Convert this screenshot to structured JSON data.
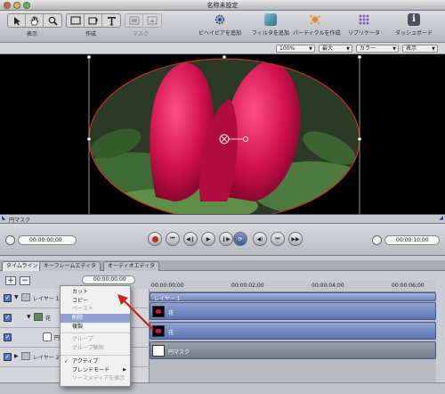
{
  "window": {
    "title": "名称未設定"
  },
  "toolbar": {
    "groups": [
      {
        "id": "view",
        "label": "表示"
      },
      {
        "id": "create",
        "label": "作成"
      },
      {
        "id": "mask",
        "label": "マスク"
      }
    ],
    "actions": [
      {
        "label": "ビヘイビアを追加",
        "icon": "gear-icon",
        "color": "#8ea3c9"
      },
      {
        "label": "フィルタを追加",
        "icon": "filter-icon",
        "color": "#5a9fb5"
      },
      {
        "label": "パーティクルを作成",
        "icon": "particles-icon",
        "color": "#d87a3a"
      },
      {
        "label": "リプリケータ",
        "icon": "replicator-icon",
        "color": "#7b5db8"
      },
      {
        "label": "ダッシュボード",
        "icon": "info-icon",
        "color": "#5a5d66"
      }
    ]
  },
  "viewbar": {
    "zoom": "100%",
    "quality": "最大",
    "channel": "カラー",
    "view": "表示"
  },
  "canvas": {
    "mask_name": "円マスク"
  },
  "transport": {
    "start_tc": "00:00:00;00",
    "end_tc": "00:00:10;00"
  },
  "tabs": [
    "タイムライン",
    "キーフレームエディタ",
    "オーディオエディタ"
  ],
  "timeline": {
    "current_tc": "00:00:00;00",
    "ruler": [
      "00:00:00;00",
      "00:00:02;00",
      "00:00:04;00",
      "00:00:06;00"
    ],
    "tracks": [
      {
        "label": "レイヤー 1",
        "indent": 0
      },
      {
        "label": "花",
        "indent": 1
      },
      {
        "label": "円マスク",
        "indent": 2
      },
      {
        "label": "レイヤー 2",
        "indent": 0
      }
    ],
    "bars": [
      {
        "label": "レイヤー 1"
      },
      {
        "label": "花"
      },
      {
        "label": "円マスク"
      }
    ]
  },
  "context_menu": {
    "items": [
      {
        "label": "カット",
        "state": "normal"
      },
      {
        "label": "コピー",
        "state": "normal"
      },
      {
        "label": "ペースト",
        "state": "disabled"
      },
      {
        "label": "削除",
        "state": "highlighted"
      },
      {
        "label": "複製",
        "state": "normal"
      },
      {
        "sep": true
      },
      {
        "label": "グループ",
        "state": "disabled"
      },
      {
        "label": "グループ解除",
        "state": "disabled"
      },
      {
        "sep": true
      },
      {
        "label": "アクティブ",
        "state": "checked"
      },
      {
        "label": "ブレンドモード",
        "state": "submenu"
      },
      {
        "label": "ソースメディアを表示",
        "state": "disabled"
      }
    ]
  }
}
